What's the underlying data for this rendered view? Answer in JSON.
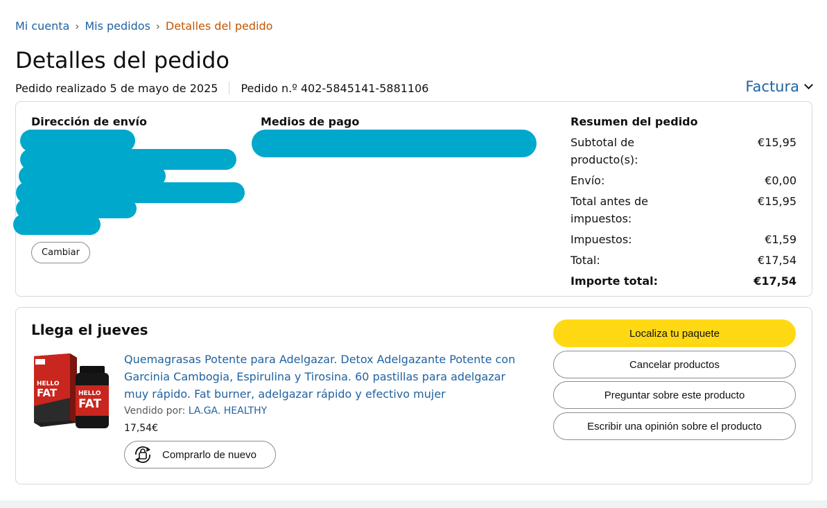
{
  "breadcrumb": {
    "account": "Mi cuenta",
    "orders": "Mis pedidos",
    "current": "Detalles del pedido",
    "separator": "›"
  },
  "page_title": "Detalles del pedido",
  "order_meta": {
    "placed": "Pedido realizado 5 de mayo de 2025",
    "number": "Pedido n.º 402-5845141-5881106"
  },
  "invoice_label": "Factura",
  "shipping": {
    "heading": "Dirección de envío",
    "change_label": "Cambiar"
  },
  "payment": {
    "heading": "Medios de pago"
  },
  "summary": {
    "heading": "Resumen del pedido",
    "rows": [
      {
        "label": "Subtotal de producto(s):",
        "value": "€15,95"
      },
      {
        "label": "Envío:",
        "value": "€0,00"
      },
      {
        "label": "Total antes de impuestos:",
        "value": "€15,95"
      },
      {
        "label": "Impuestos:",
        "value": "€1,59"
      },
      {
        "label": "Total:",
        "value": "€17,54"
      },
      {
        "label": "Importe total:",
        "value": "€17,54"
      }
    ]
  },
  "shipment": {
    "arrival": "Llega el jueves",
    "product_title": "Quemagrasas Potente para Adelgazar. Detox Adelgazante Potente con Garcinia Cambogia, Espirulina y Tirosina. 60 pastillas para adelgazar muy rápido. Fat burner, adelgazar rápido y efectivo mujer",
    "seller_prefix": "Vendido por:",
    "seller_name": "LA.GA. HEALTHY",
    "price": "17,54€",
    "buy_again_label": "Comprarlo de nuevo",
    "product_image_text": [
      "HELLO",
      "FAT"
    ],
    "actions": {
      "track": "Localiza tu paquete",
      "cancel": "Cancelar productos",
      "ask": "Preguntar sobre este producto",
      "review": "Escribir una opinión sobre el producto"
    }
  },
  "colors": {
    "link": "#2162a1",
    "breadcrumb_current": "#c45500",
    "primary_button": "#ffd814",
    "redaction": "#00a8cc",
    "border": "#d5d9d9"
  }
}
